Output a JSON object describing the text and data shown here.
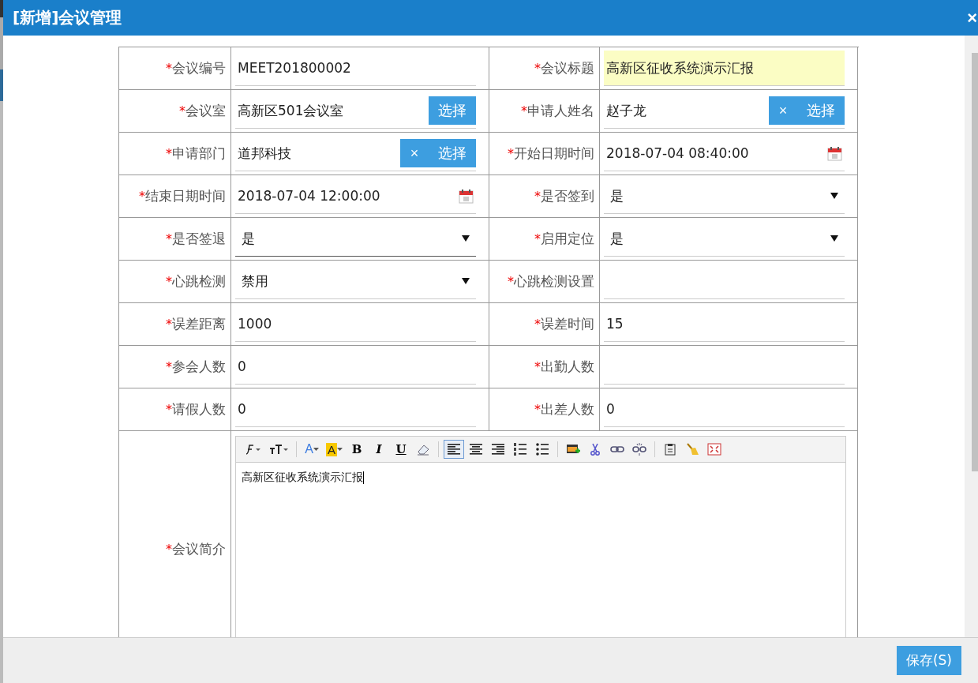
{
  "dialog": {
    "title": "[新增]会议管理",
    "close": "×"
  },
  "fields": [
    {
      "label": "会议编号",
      "mark": "*",
      "kind": "text",
      "value": "MEET201800002"
    },
    {
      "label": "会议标题",
      "mark": "*",
      "kind": "text",
      "value": "高新区征收系统演示汇报",
      "highlighted": true
    },
    {
      "label": "会议室",
      "mark": "*",
      "kind": "picker",
      "value": "高新区501会议室",
      "button": "选择"
    },
    {
      "label": "申请人姓名",
      "mark": "*",
      "kind": "picker",
      "value": "赵子龙",
      "clear": "×",
      "button": "选择"
    },
    {
      "label": "申请部门",
      "mark": "*",
      "kind": "picker",
      "value": "道邦科技",
      "clear": "×",
      "button": "选择"
    },
    {
      "label": "开始日期时间",
      "mark": "*",
      "kind": "date",
      "value": "2018-07-04 08:40:00"
    },
    {
      "label": "结束日期时间",
      "mark": "*",
      "kind": "date",
      "value": "2018-07-04 12:00:00"
    },
    {
      "label": "是否签到",
      "mark": "*",
      "kind": "select",
      "value": "是",
      "focused": false
    },
    {
      "label": "是否签退",
      "mark": "*",
      "kind": "select",
      "value": "是",
      "focused": true
    },
    {
      "label": "启用定位",
      "mark": "*",
      "kind": "select",
      "value": "是",
      "focused": false
    },
    {
      "label": "心跳检测",
      "mark": "*",
      "kind": "select",
      "value": "禁用",
      "focused": false
    },
    {
      "label": "心跳检测设置",
      "mark": "*",
      "kind": "text"
    },
    {
      "label": "误差距离",
      "mark": "*",
      "kind": "text",
      "value": "1000"
    },
    {
      "label": "误差时间",
      "mark": "*",
      "kind": "text",
      "value": "15"
    },
    {
      "label": "参会人数",
      "mark": "*",
      "kind": "text",
      "value": "0"
    },
    {
      "label": "出勤人数",
      "mark": "*",
      "kind": "text"
    },
    {
      "label": "请假人数",
      "mark": "*",
      "kind": "text",
      "value": "0"
    },
    {
      "label": "出差人数",
      "mark": "*",
      "kind": "text",
      "value": "0"
    }
  ],
  "editor": {
    "label": "会议简介",
    "mark": "*",
    "content": "高新区征收系统演示汇报",
    "toolbar": [
      {
        "kind": "font-family"
      },
      {
        "kind": "font-size"
      },
      {
        "kind": "separator"
      },
      {
        "kind": "font-color",
        "label": "A"
      },
      {
        "kind": "back-color",
        "label": "A"
      },
      {
        "kind": "bold",
        "label": "B"
      },
      {
        "kind": "italic",
        "label": "I"
      },
      {
        "kind": "underline",
        "label": "U"
      },
      {
        "kind": "eraser"
      },
      {
        "kind": "separator"
      },
      {
        "kind": "align-left",
        "selected": true
      },
      {
        "kind": "align-center",
        "selected": false
      },
      {
        "kind": "align-right",
        "selected": false
      },
      {
        "kind": "ordered-list"
      },
      {
        "kind": "unordered-list"
      },
      {
        "kind": "separator"
      },
      {
        "kind": "image"
      },
      {
        "kind": "cut"
      },
      {
        "kind": "link"
      },
      {
        "kind": "unlink"
      },
      {
        "kind": "separator"
      },
      {
        "kind": "paste"
      },
      {
        "kind": "clean"
      },
      {
        "kind": "fullscreen"
      }
    ]
  },
  "footer": {
    "save": "保存(S)"
  }
}
